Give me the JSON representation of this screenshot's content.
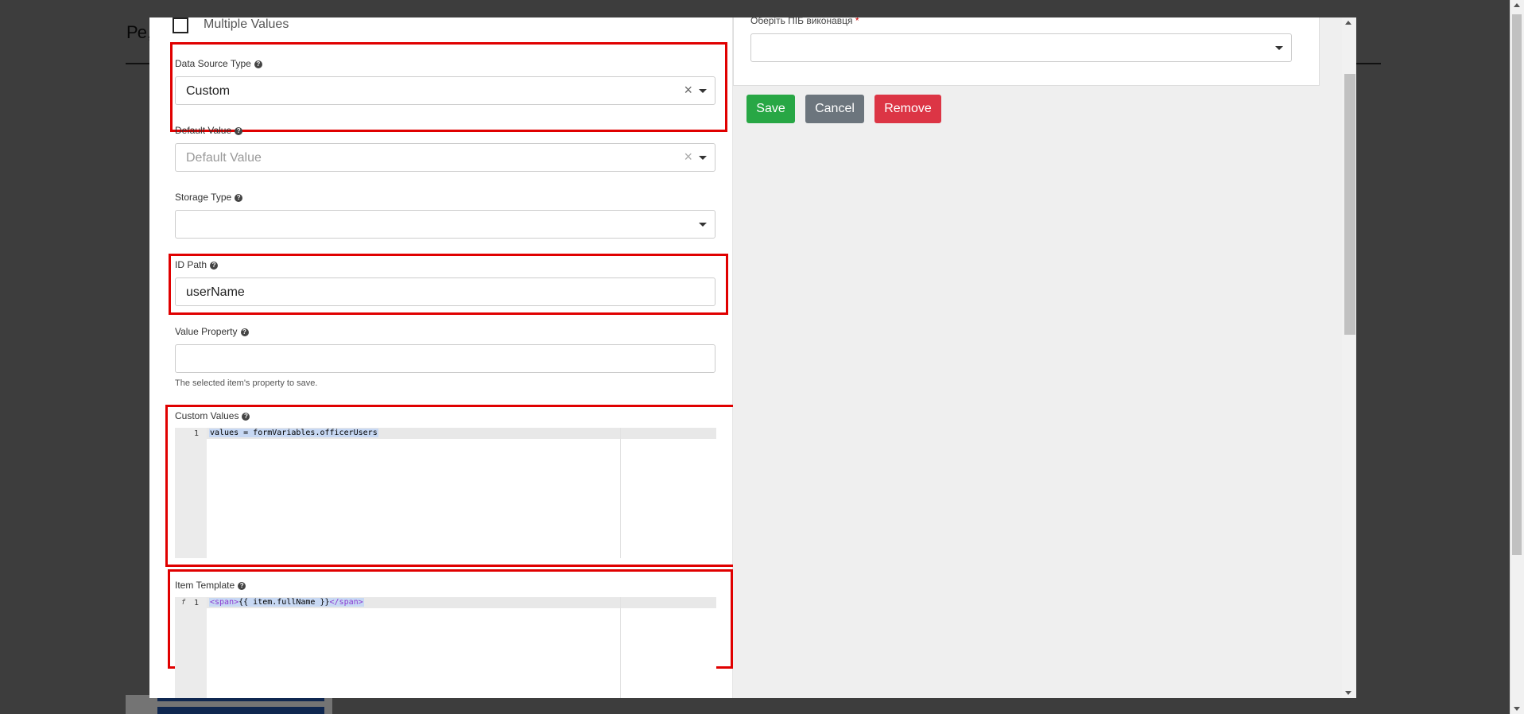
{
  "background_page": {
    "title_fragment": "Ре,"
  },
  "left_form": {
    "multiple_values_label": "Multiple Values",
    "data_source_type": {
      "label": "Data Source Type",
      "value": "Custom"
    },
    "default_value": {
      "label": "Default Value",
      "placeholder": "Default Value"
    },
    "storage_type": {
      "label": "Storage Type",
      "value": ""
    },
    "id_path": {
      "label": "ID Path",
      "value": "userName"
    },
    "value_property": {
      "label": "Value Property",
      "value": "",
      "help_text": "The selected item's property to save."
    },
    "custom_values": {
      "label": "Custom Values",
      "line_number": "1",
      "code": "values = formVariables.officerUsers"
    },
    "item_template": {
      "label": "Item Template",
      "line_number": "1",
      "fold_marker": "f",
      "code_open_tag": "<span>",
      "code_body": "{{ item.fullName }}",
      "code_close_tag": "</span>"
    }
  },
  "right_panel": {
    "select_label": "Оберіть ПІБ виконавця",
    "required_marker": "*",
    "buttons": {
      "save": "Save",
      "cancel": "Cancel",
      "remove": "Remove"
    }
  },
  "colors": {
    "highlight_box": "#e00000",
    "save": "#28a745",
    "cancel": "#6c757d",
    "remove": "#dc3545"
  },
  "icons": [
    "help-icon",
    "clear-icon",
    "chevron-down-icon",
    "checkbox-icon"
  ]
}
